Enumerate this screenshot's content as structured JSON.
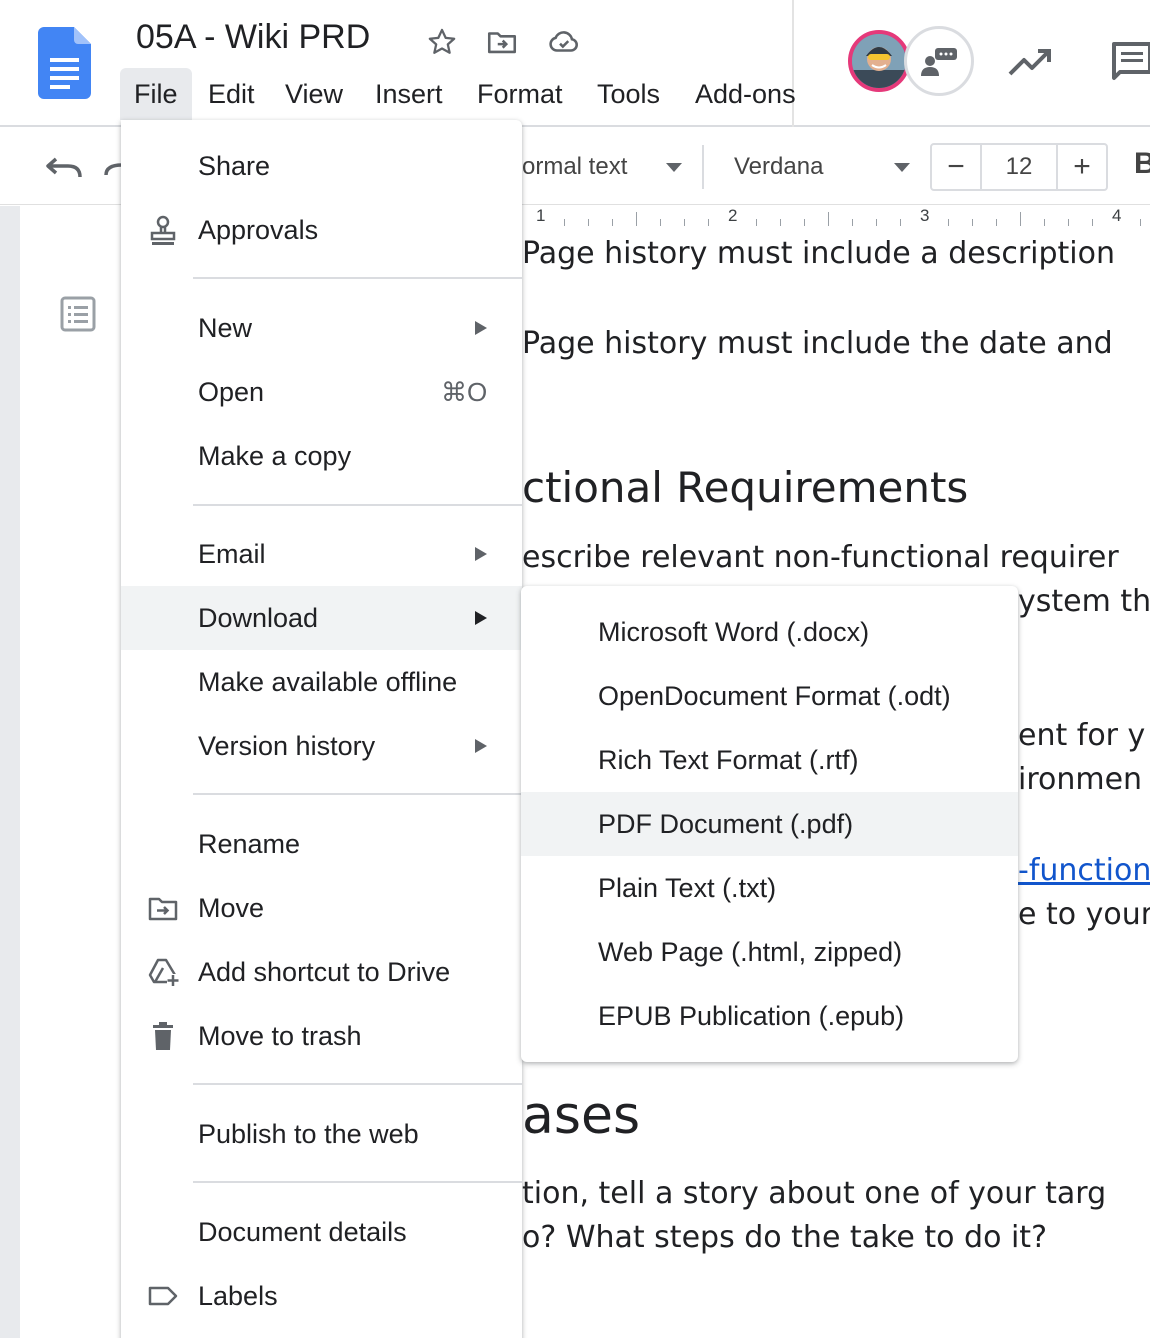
{
  "header": {
    "title": "05A - Wiki PRD",
    "menus": [
      "File",
      "Edit",
      "View",
      "Insert",
      "Format",
      "Tools",
      "Add-ons"
    ],
    "active_menu": "File",
    "icons": {
      "logo": "google-docs-logo",
      "star": "star-icon",
      "move": "move-to-folder-icon",
      "cloud": "cloud-saved-icon",
      "avatar": "user-avatar",
      "chat": "chat-icon",
      "activity": "activity-trend-icon",
      "comments": "comment-icon"
    }
  },
  "toolbar": {
    "undo_icon": "undo-icon",
    "redo_icon": "redo-icon",
    "style_value": "ormal text",
    "font_value": "Verdana",
    "font_size": "12",
    "decrease_label": "−",
    "increase_label": "+",
    "bold_label": "B"
  },
  "ruler": {
    "numbers": [
      "1",
      "2",
      "3",
      "4"
    ]
  },
  "document": {
    "lines": [
      "Page history must include a description",
      "Page history must include the date and",
      "ctional Requirements",
      "escribe relevant non-functional requirer",
      "ystem th",
      "ent for y",
      "ironmen",
      "-function",
      "e to your",
      "ases",
      "tion, tell a story about one of your targ",
      "o? What steps do the take to do it?"
    ]
  },
  "file_menu": {
    "items": [
      {
        "label": "Share",
        "icon": null
      },
      {
        "label": "Approvals",
        "icon": "approvals-stamp-icon"
      },
      {
        "label": "New",
        "submenu": true
      },
      {
        "label": "Open",
        "shortcut": "⌘O"
      },
      {
        "label": "Make a copy"
      },
      {
        "label": "Email",
        "submenu": true
      },
      {
        "label": "Download",
        "submenu": true,
        "highlighted": true
      },
      {
        "label": "Make available offline"
      },
      {
        "label": "Version history",
        "submenu": true
      },
      {
        "label": "Rename"
      },
      {
        "label": "Move",
        "icon": "move-to-folder-icon"
      },
      {
        "label": "Add shortcut to Drive",
        "icon": "add-drive-shortcut-icon"
      },
      {
        "label": "Move to trash",
        "icon": "trash-icon"
      },
      {
        "label": "Publish to the web"
      },
      {
        "label": "Document details"
      },
      {
        "label": "Labels",
        "icon": "label-icon"
      }
    ]
  },
  "download_menu": {
    "items": [
      {
        "label": "Microsoft Word (.docx)"
      },
      {
        "label": "OpenDocument Format (.odt)"
      },
      {
        "label": "Rich Text Format (.rtf)"
      },
      {
        "label": "PDF Document (.pdf)",
        "highlighted": true
      },
      {
        "label": "Plain Text (.txt)"
      },
      {
        "label": "Web Page (.html, zipped)"
      },
      {
        "label": "EPUB Publication (.epub)"
      }
    ]
  },
  "colors": {
    "docs_blue": "#4285f4",
    "link": "#1155cc",
    "menu_highlight": "#f1f3f4",
    "avatar_ring": "#e5397a"
  }
}
